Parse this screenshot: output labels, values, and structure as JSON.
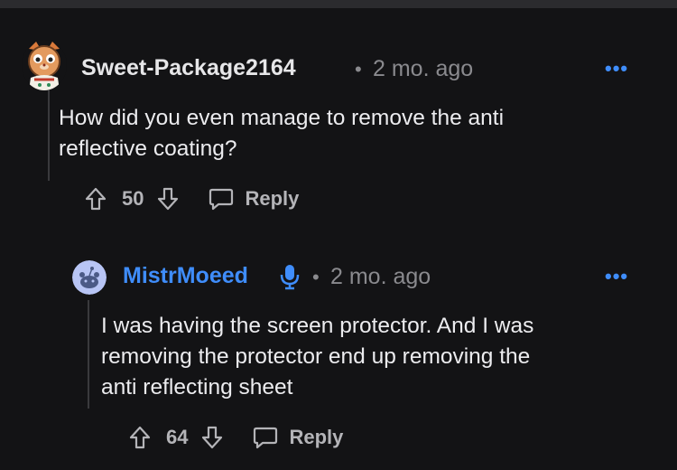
{
  "comments": [
    {
      "username": "Sweet-Package2164",
      "separator": "•",
      "time": "2 mo. ago",
      "more": "•••",
      "body_lines": [
        "How did you even manage to remove the anti",
        "reflective coating?"
      ],
      "score": "50",
      "reply_label": "Reply",
      "username_color": "#e6e6e8"
    },
    {
      "username": "MistrMoeed",
      "separator": "•",
      "time": "2 mo. ago",
      "more": "•••",
      "body_lines": [
        "I was having the screen protector. And I was",
        "removing the protector end up removing the",
        "anti reflecting sheet"
      ],
      "score": "64",
      "reply_label": "Reply",
      "username_color": "#3f8dfb"
    }
  ],
  "colors": {
    "background": "#131315",
    "accent": "#3f8dfb",
    "muted": "#8a8a8e",
    "action": "#b4b4b8"
  },
  "icons": {
    "upvote": "arrow-up-outline-icon",
    "downvote": "arrow-down-outline-icon",
    "reply": "speech-bubble-icon",
    "mic": "microphone-icon"
  }
}
